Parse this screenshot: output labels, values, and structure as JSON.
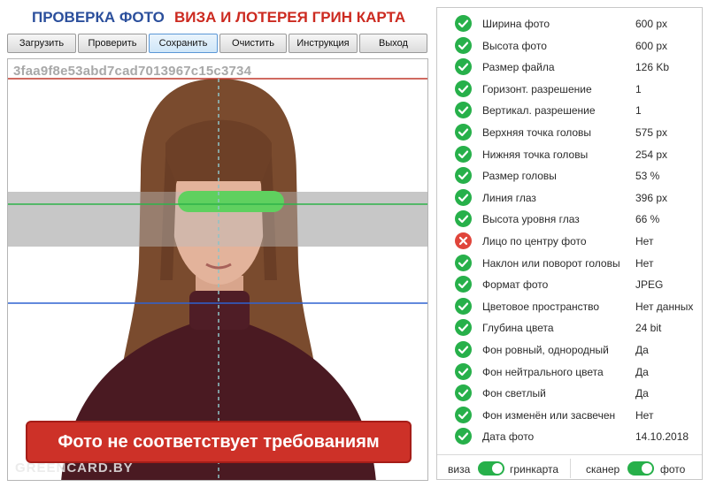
{
  "header": {
    "title_left": "ПРОВЕРКА ФОТО",
    "title_right": "ВИЗА И ЛОТЕРЕЯ ГРИН КАРТА"
  },
  "toolbar": {
    "load": "Загрузить",
    "check": "Проверить",
    "save": "Сохранить",
    "clear": "Очистить",
    "instruction": "Инструкция",
    "exit": "Выход"
  },
  "photo": {
    "hash": "3faa9f8e53abd7cad7013967c15c3734",
    "warning": "Фото не соответствует требованиям",
    "watermark": "GREENCARD.BY"
  },
  "checks": [
    {
      "status": "ok",
      "label": "Ширина фото",
      "value": "600 px"
    },
    {
      "status": "ok",
      "label": "Высота фото",
      "value": "600 px"
    },
    {
      "status": "ok",
      "label": "Размер файла",
      "value": "126 Kb"
    },
    {
      "status": "ok",
      "label": "Горизонт. разрешение",
      "value": "1"
    },
    {
      "status": "ok",
      "label": "Вертикал. разрешение",
      "value": "1"
    },
    {
      "status": "ok",
      "label": "Верхняя точка головы",
      "value": "575 px"
    },
    {
      "status": "ok",
      "label": "Нижняя точка головы",
      "value": "254 px"
    },
    {
      "status": "ok",
      "label": "Размер головы",
      "value": "53 %"
    },
    {
      "status": "ok",
      "label": "Линия глаз",
      "value": "396 px"
    },
    {
      "status": "ok",
      "label": "Высота уровня глаз",
      "value": "66 %"
    },
    {
      "status": "err",
      "label": "Лицо по центру фото",
      "value": "Нет"
    },
    {
      "status": "ok",
      "label": "Наклон или поворот головы",
      "value": "Нет"
    },
    {
      "status": "ok",
      "label": "Формат фото",
      "value": "JPEG"
    },
    {
      "status": "ok",
      "label": "Цветовое пространство",
      "value": "Нет данных"
    },
    {
      "status": "ok",
      "label": "Глубина цвета",
      "value": "24 bit"
    },
    {
      "status": "ok",
      "label": "Фон ровный, однородный",
      "value": "Да"
    },
    {
      "status": "ok",
      "label": "Фон нейтрального цвета",
      "value": "Да"
    },
    {
      "status": "ok",
      "label": "Фон светлый",
      "value": "Да"
    },
    {
      "status": "ok",
      "label": "Фон изменён или засвечен",
      "value": "Нет"
    },
    {
      "status": "ok",
      "label": "Дата фото",
      "value": "14.10.2018"
    }
  ],
  "footer": {
    "left_a": "виза",
    "left_b": "гринкарта",
    "right_a": "сканер",
    "right_b": "фото",
    "toggle_left_on": true,
    "toggle_right_on": true
  },
  "colors": {
    "ok": "#27b04a",
    "err": "#e0453b",
    "title_blue": "#2b4f9c",
    "title_red": "#cc2a20",
    "warning_bg": "#cd3128"
  }
}
